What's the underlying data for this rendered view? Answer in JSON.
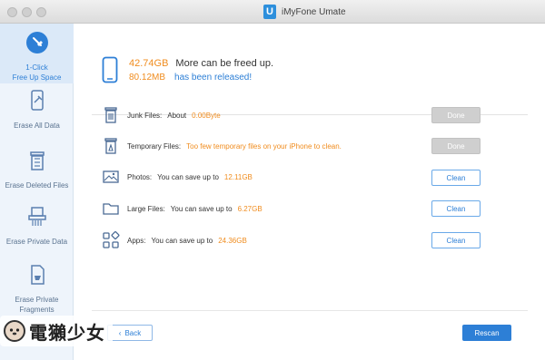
{
  "window": {
    "title": "iMyFone Umate",
    "logo_letter": "U"
  },
  "sidebar": {
    "items": [
      {
        "label_line1": "1-Click",
        "label_line2": "Free Up Space",
        "icon": "broom-icon",
        "active": true
      },
      {
        "label_line1": "Erase All Data",
        "label_line2": "",
        "icon": "erase-phone-icon",
        "active": false
      },
      {
        "label_line1": "Erase Deleted Files",
        "label_line2": "",
        "icon": "trash-icon",
        "active": false
      },
      {
        "label_line1": "Erase Private Data",
        "label_line2": "",
        "icon": "shredder-icon",
        "active": false
      },
      {
        "label_line1": "Erase Private",
        "label_line2": "Fragments",
        "icon": "fragments-icon",
        "active": false
      }
    ]
  },
  "summary": {
    "freeable_size": "42.74GB",
    "freeable_text": "More can be freed up.",
    "released_size": "80.12MB",
    "released_text": "has been released!"
  },
  "rows": [
    {
      "icon": "junk-bin-icon",
      "label": "Junk Files:",
      "detail": "About",
      "value": "0.00Byte",
      "button": "Done",
      "button_state": "done"
    },
    {
      "icon": "temp-bin-icon",
      "label": "Temporary Files:",
      "detail": "Too few temporary files on your iPhone to clean.",
      "value": "",
      "button": "Done",
      "button_state": "done"
    },
    {
      "icon": "photo-icon",
      "label": "Photos:",
      "detail": "You can save up to",
      "value": "12.11GB",
      "button": "Clean",
      "button_state": "clean"
    },
    {
      "icon": "folder-icon",
      "label": "Large Files:",
      "detail": "You can save up to",
      "value": "6.27GB",
      "button": "Clean",
      "button_state": "clean"
    },
    {
      "icon": "apps-icon",
      "label": "Apps:",
      "detail": "You can save up to",
      "value": "24.36GB",
      "button": "Clean",
      "button_state": "clean"
    }
  ],
  "footer": {
    "back_label": "Back",
    "rescan_label": "Rescan"
  },
  "watermark": {
    "text": "電獺少女"
  },
  "colors": {
    "accent": "#2d7fd6",
    "highlight": "#f08c1e",
    "sidebar_bg": "#eef4fb"
  }
}
